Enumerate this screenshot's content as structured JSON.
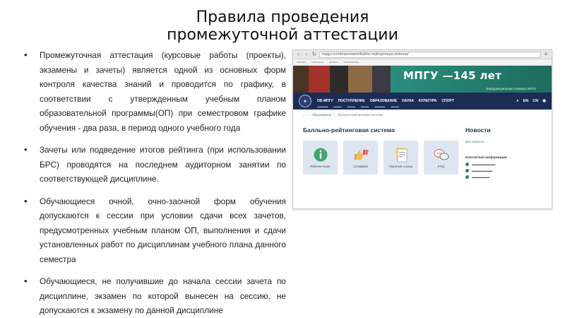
{
  "slide": {
    "title_line1": "Правила проведения",
    "title_line2": "промежуточной аттестации",
    "bullets": [
      "Промежуточная аттестация (курсовые работы (проекты), экзамены и зачеты) является одной из основных форм контроля качества знаний и проводится по графику, в соответствии с утвержденным учебным планом образовательной программы(ОП) при семестровом графике обучения - два раза, в период одного учебного года",
      "Зачеты или подведение итогов рейтинга (при использовании БРС) проводятся на последнем аудиторном занятии по соответствующей дисциплине.",
      "Обучающиеся очной, очно-заочной форм обучения допускаются к сессии при условии сдачи всех зачетов, предусмотренных учебным планом ОП, выполнения и сдачи установленных работ по дисциплинам учебного плана данного семестра",
      "Обучающиеся, не получившие до начала сессии зачета по дисциплине, экзамен по которой вынесен на сессию, не допускаются к экзамену по данной дисциплине"
    ]
  },
  "browser": {
    "url": "mpgu.su/obrazovanie/ballno-rejtingovaya-sistema/"
  },
  "site": {
    "banner_text": "МПГУ —145 лет",
    "banner_subtext": "Информационные сервисы МПГУ",
    "nav": [
      "ОБ МПГУ",
      "ПОСТУПЛЕНИЕ",
      "ОБРАЗОВАНИЕ",
      "НАУКА",
      "КУЛЬТУРА",
      "СПОРТ"
    ],
    "lang_en": "EN",
    "lang_cn": "CN",
    "breadcrumbs": [
      "Образование",
      "Балльно-рейтинговая система"
    ],
    "page_title": "Балльно-рейтинговая система",
    "tiles": [
      {
        "label": "Рейтинг-план"
      },
      {
        "label": "10 мифов"
      },
      {
        "label": "Научные статьи"
      },
      {
        "label": "FAQ"
      }
    ],
    "news_title": "Новости",
    "news_link": "Все новости  ›",
    "contact_title": "Контактная информация"
  },
  "colors": {
    "banner_green": "#2a8e7c",
    "nav_navy": "#1c2c55",
    "accent_teal": "#2d7f74"
  }
}
